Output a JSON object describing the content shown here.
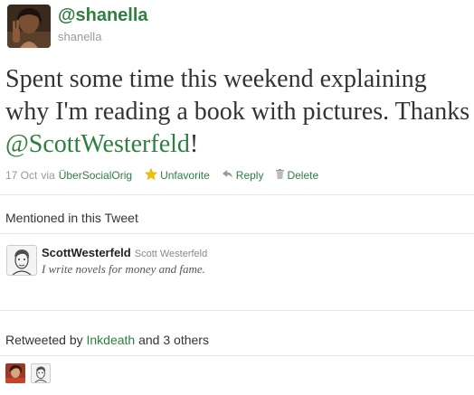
{
  "tweet": {
    "handle": "@shanella",
    "username": "shanella",
    "text_part1": "Spent some time this weekend explaining why I'm reading a book with pictures. Thanks ",
    "mention": "@ScottWesterfeld",
    "text_part2": "!"
  },
  "meta": {
    "date": "17 Oct",
    "via_label": "via",
    "via_app": "ÜberSocialOrig",
    "unfavorite_label": "Unfavorite",
    "reply_label": "Reply",
    "delete_label": "Delete"
  },
  "mentioned": {
    "section_title": "Mentioned in this Tweet",
    "screen_name": "ScottWesterfeld",
    "full_name": "Scott Westerfeld",
    "bio": "I write novels for money and fame."
  },
  "retweets": {
    "prefix": "Retweeted by",
    "user": "Inkdeath",
    "suffix": "and 3 others"
  },
  "icons": {
    "star": "star-icon",
    "reply": "reply-icon",
    "trash": "trash-icon"
  },
  "colors": {
    "accent": "#2f7f3f",
    "star": "#f2c200",
    "muted": "#999999"
  }
}
